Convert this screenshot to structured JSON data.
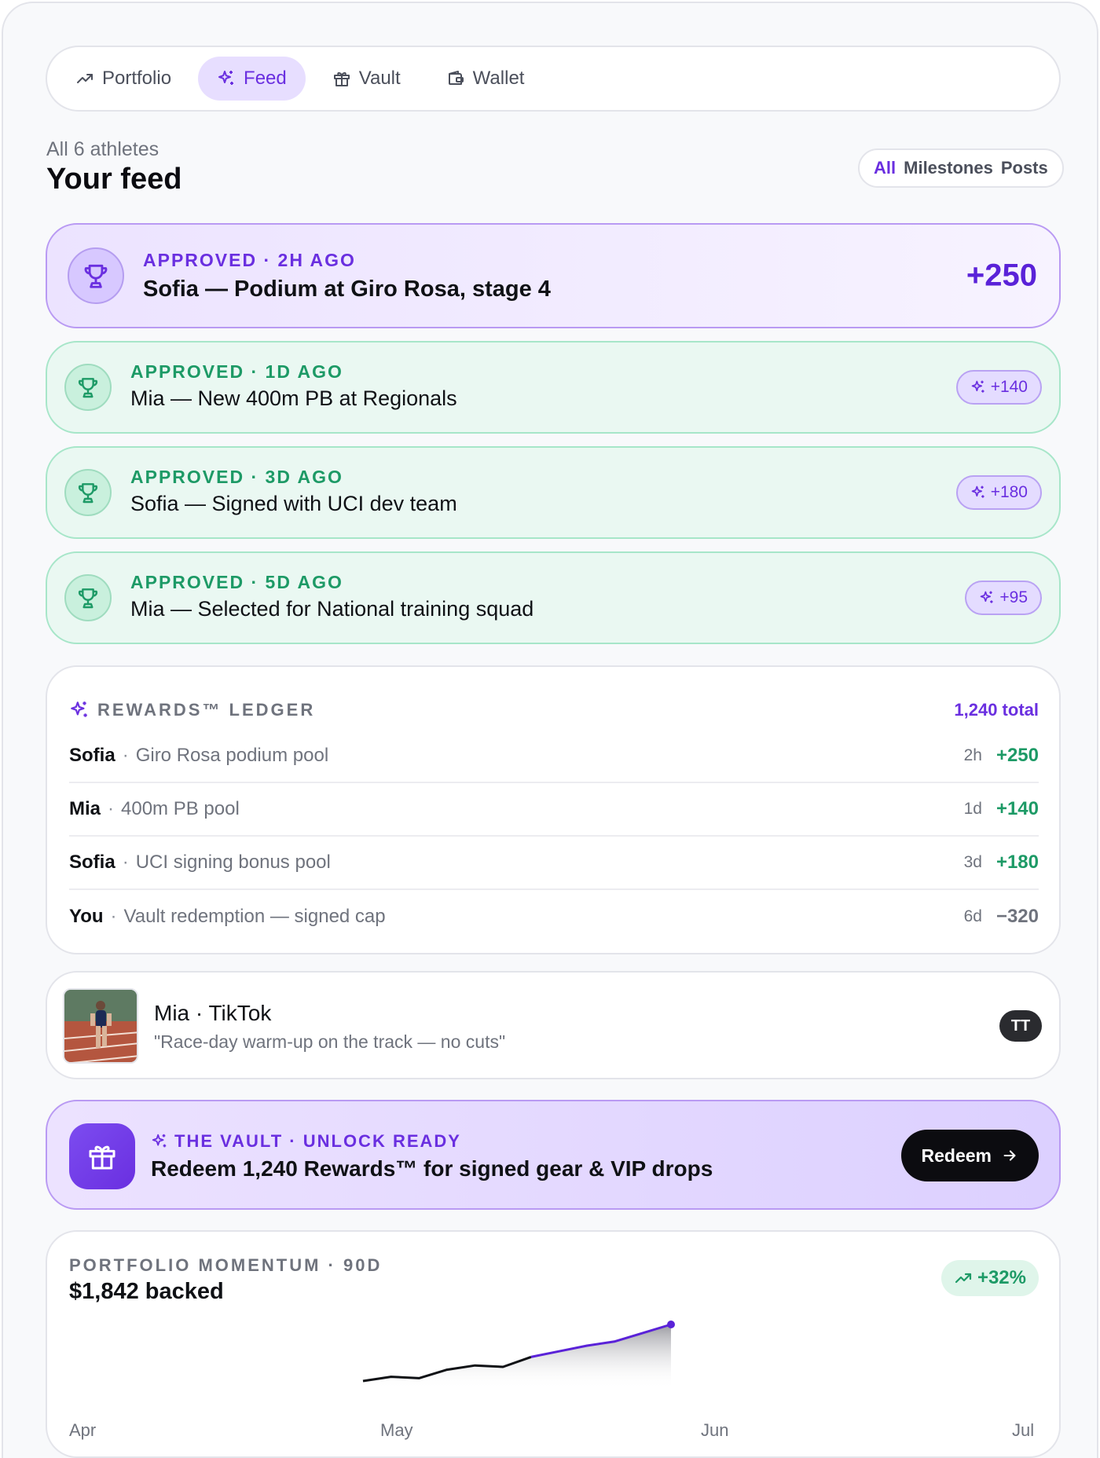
{
  "nav": {
    "tabs": [
      {
        "label": "Portfolio",
        "icon": "trending-up-icon"
      },
      {
        "label": "Feed",
        "icon": "sparkles-icon",
        "active": true
      },
      {
        "label": "Vault",
        "icon": "gift-icon"
      },
      {
        "label": "Wallet",
        "icon": "wallet-icon"
      }
    ]
  },
  "header": {
    "subtitle": "All 6 athletes",
    "title": "Your feed",
    "filters": [
      "All",
      "Milestones",
      "Posts"
    ],
    "active_filter": "All"
  },
  "milestones": [
    {
      "meta": "APPROVED · 2H AGO",
      "text": "Sofia — Podium at Giro Rosa, stage 4",
      "reward": "+250",
      "featured": true
    },
    {
      "meta": "APPROVED · 1D AGO",
      "text": "Mia — New 400m PB at Regionals",
      "reward": "+140"
    },
    {
      "meta": "APPROVED · 3D AGO",
      "text": "Sofia — Signed with UCI dev team",
      "reward": "+180"
    },
    {
      "meta": "APPROVED · 5D AGO",
      "text": "Mia — Selected for National training squad",
      "reward": "+95"
    }
  ],
  "ledger": {
    "title": "REWARDS™ LEDGER",
    "total": "1,240 total",
    "rows": [
      {
        "who": "Sofia",
        "desc": "Giro Rosa podium pool",
        "ago": "2h",
        "amount": "+250"
      },
      {
        "who": "Mia",
        "desc": "400m PB pool",
        "ago": "1d",
        "amount": "+140"
      },
      {
        "who": "Sofia",
        "desc": "UCI signing bonus pool",
        "ago": "3d",
        "amount": "+180"
      },
      {
        "who": "You",
        "desc": "Vault redemption — signed cap",
        "ago": "6d",
        "amount": "−320"
      }
    ]
  },
  "post": {
    "title": "Mia · TikTok",
    "quote": "\"Race-day warm-up on the track — no cuts\"",
    "platform_badge": "TT"
  },
  "vault": {
    "meta": "THE VAULT · UNLOCK READY",
    "text": "Redeem 1,240 Rewards™ for signed gear & VIP drops",
    "button": "Redeem"
  },
  "momentum": {
    "label": "PORTFOLIO MOMENTUM · 90D",
    "value": "$1,842 backed",
    "change": "+32%"
  },
  "chart_data": {
    "type": "area",
    "x_labels": [
      "Apr",
      "May",
      "Jun",
      "Jul"
    ],
    "values": [
      100,
      103,
      102,
      108,
      111,
      110,
      117,
      121,
      125,
      128,
      134,
      140
    ],
    "line_color": "#0f1115",
    "accent_color": "#5a22d8"
  },
  "colors": {
    "accent": "#6a2fe0",
    "success": "#1d9a66"
  }
}
